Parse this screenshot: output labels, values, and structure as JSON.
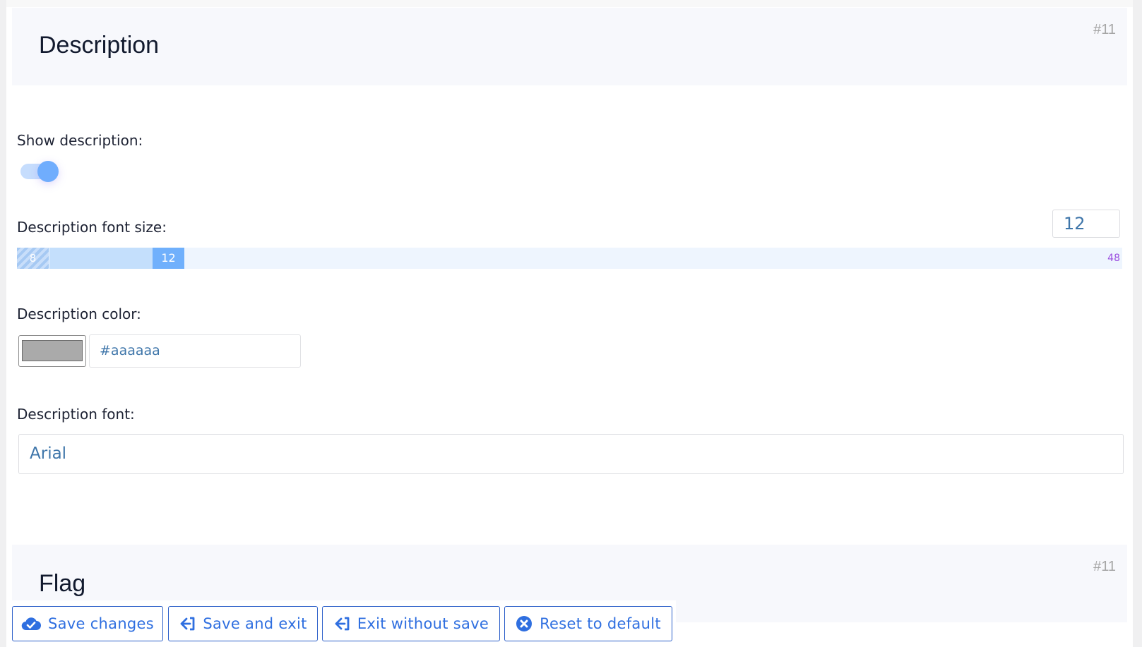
{
  "sections": {
    "description": {
      "title": "Description",
      "number": "#11"
    },
    "flag": {
      "title": "Flag",
      "number": "#11"
    }
  },
  "fields": {
    "show_description": {
      "label": "Show description:",
      "enabled": true
    },
    "font_size": {
      "label": "Description font size:",
      "value": "12",
      "min": "8",
      "max": "48",
      "handle_label": "12"
    },
    "color": {
      "label": "Description color:",
      "value": "#aaaaaa",
      "swatch_color": "#aaaaaa"
    },
    "font": {
      "label": "Description font:",
      "value": "Arial"
    }
  },
  "toolbar": {
    "save_changes": "Save changes",
    "save_and_exit": "Save and exit",
    "exit_without_save": "Exit without save",
    "reset_to_default": "Reset to default"
  },
  "colors": {
    "accent": "#2f6fe0",
    "toggle_on": "#70adfd",
    "range_max_label": "#9b4ee0",
    "input_text": "#3f76aa"
  }
}
